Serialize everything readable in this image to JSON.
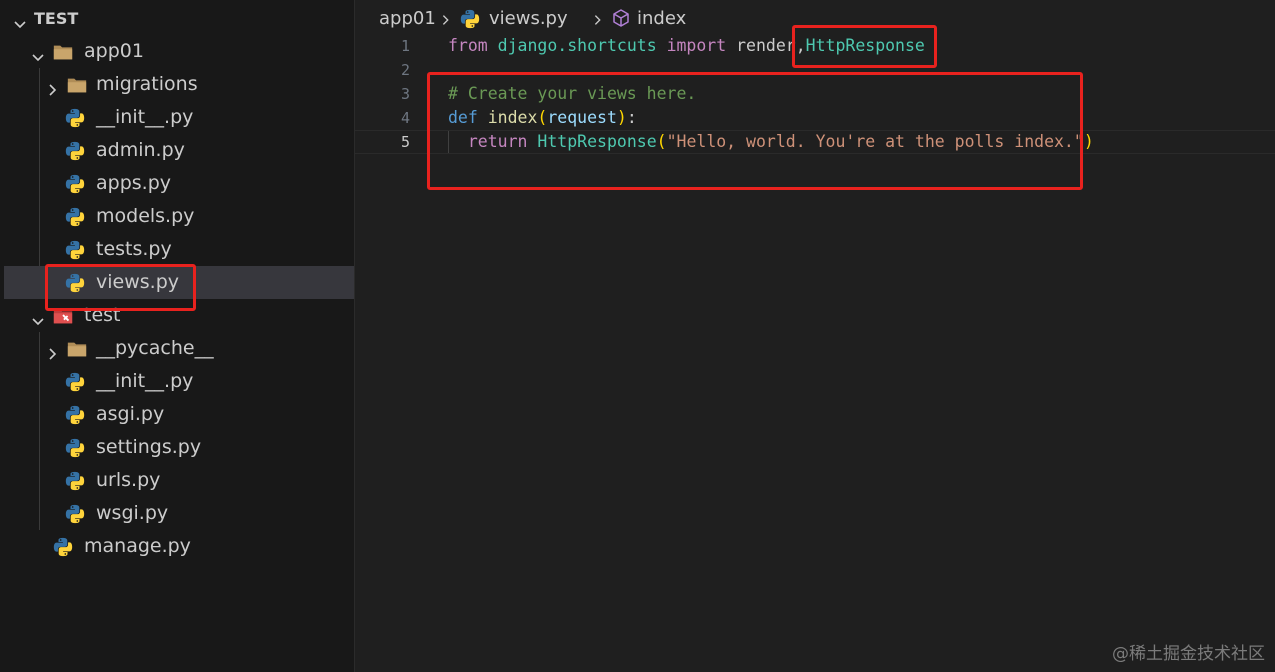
{
  "explorer": {
    "root_label": "TEST",
    "items": [
      {
        "label": "app01",
        "type": "folder"
      },
      {
        "label": "migrations",
        "type": "folder"
      },
      {
        "label": "__init__.py",
        "type": "python"
      },
      {
        "label": "admin.py",
        "type": "python"
      },
      {
        "label": "apps.py",
        "type": "python"
      },
      {
        "label": "models.py",
        "type": "python"
      },
      {
        "label": "tests.py",
        "type": "python"
      },
      {
        "label": "views.py",
        "type": "python",
        "selected": true
      },
      {
        "label": "test",
        "type": "folder"
      },
      {
        "label": "__pycache__",
        "type": "folder"
      },
      {
        "label": "__init__.py",
        "type": "python"
      },
      {
        "label": "asgi.py",
        "type": "python"
      },
      {
        "label": "settings.py",
        "type": "python"
      },
      {
        "label": "urls.py",
        "type": "python"
      },
      {
        "label": "wsgi.py",
        "type": "python"
      },
      {
        "label": "manage.py",
        "type": "python"
      }
    ]
  },
  "breadcrumb": {
    "folder": "app01",
    "file": "views.py",
    "symbol": "index"
  },
  "editor": {
    "lines": [
      {
        "n": "1",
        "tokens": [
          {
            "t": "from",
            "c": "kw-ctl"
          },
          {
            "t": " django.shortcuts ",
            "c": "cls"
          },
          {
            "t": "import",
            "c": "kw-ctl"
          },
          {
            "t": " render,",
            "c": ""
          },
          {
            "t": "HttpResponse",
            "c": "cls"
          }
        ]
      },
      {
        "n": "2",
        "tokens": []
      },
      {
        "n": "3",
        "tokens": [
          {
            "t": "# Create your views here.",
            "c": "cmt"
          }
        ]
      },
      {
        "n": "4",
        "tokens": [
          {
            "t": "def",
            "c": "kw"
          },
          {
            "t": " ",
            "c": ""
          },
          {
            "t": "index",
            "c": "fn"
          },
          {
            "t": "(",
            "c": "brk1"
          },
          {
            "t": "request",
            "c": "param"
          },
          {
            "t": ")",
            "c": "brk1"
          },
          {
            "t": ":",
            "c": ""
          }
        ]
      },
      {
        "n": "5",
        "active": true,
        "tokens": [
          {
            "t": "  ",
            "c": ""
          },
          {
            "t": "return",
            "c": "kw-ctl"
          },
          {
            "t": " ",
            "c": ""
          },
          {
            "t": "HttpResponse",
            "c": "cls"
          },
          {
            "t": "(",
            "c": "brk1"
          },
          {
            "t": "\"Hello, world. You're at the polls index.\"",
            "c": "str"
          },
          {
            "t": ")",
            "c": "brk1"
          }
        ]
      }
    ]
  },
  "colors": {
    "annotation_red": "#e8221e",
    "python_blue": "#3572a5",
    "python_yellow": "#ffd43b",
    "folder": "#b08d57"
  },
  "watermark": "@稀土掘金技术社区"
}
